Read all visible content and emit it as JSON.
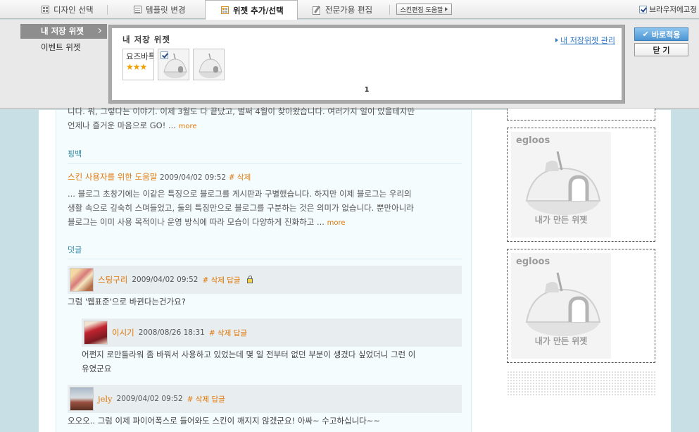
{
  "toolbar": {
    "tabs": [
      {
        "label": "디자인 선택",
        "icon": "grid-icon"
      },
      {
        "label": "템플릿 변경",
        "icon": "lines-icon"
      },
      {
        "label": "위젯 추가/선택",
        "icon": "widget-icon",
        "active": true
      },
      {
        "label": "전문가용 편집",
        "icon": "edit-icon"
      }
    ],
    "help_label": "스킨편집 도움말",
    "fix_label": "브라우저에고정",
    "fix_checked": true
  },
  "panel": {
    "menu": [
      {
        "label": "내 저장 위젯",
        "active": true
      },
      {
        "label": "이벤트 위젯",
        "active": false
      }
    ],
    "box_title": "내 저장 위젯",
    "manage_link": "내 저장위젯 관리",
    "widgets": [
      {
        "label": "요즈바특",
        "rating": "★★★"
      },
      {
        "label": "",
        "checked": true
      },
      {
        "label": ""
      }
    ],
    "page": "1",
    "apply_label": "바로적용",
    "close_label": "닫 기"
  },
  "post": {
    "excerpt_line1": "니다. 뭐, 그렇다는 이야기. 이제 3월도 다 끝났고, 벌써 4월이 찾아왔습니다. 여러가지 일이 있을테지만",
    "excerpt_line2": "언제나 즐거운 마음으로 GO! ...",
    "more": "more"
  },
  "trackback": {
    "section": "핑백",
    "title": "스킨 사용자를 위한 도움말",
    "date": "2009/04/02 09:52",
    "delete": "# 삭제",
    "body_line1": "... 블로그 초창기에는 이같은 특징으로 블로그를 게시판과 구별했습니다. 하지만 이제 블로그는 우리의",
    "body_line2": "생활 속으로 깊숙히 스며들었고, 둘의 특징만으로 블로그를 구분하는 것은 의미가 없습니다. 뿐만아니라",
    "body_line3": "블로그는 이미 사용 목적이나 운영 방식에 따라 모습이 다양하게 진화하고 ...",
    "more": "more"
  },
  "comments": {
    "section": "덧글",
    "items": [
      {
        "name": "스팅구리",
        "date": "2009/04/02 09:52",
        "actions": "# 삭제 답글",
        "body": "그럼 '웹표준'으로 바뀐다는건가요?"
      },
      {
        "name": "이시기",
        "date": "2008/08/26 18:31",
        "actions": "# 삭제 답글",
        "body_line1": "어쩐지 로만틀라워 좀 바꿔서 사용하고 있었는데 몇 일 전부터 없던 부분이 생겼다 싶었더니 그런 이",
        "body_line2": "유였군요"
      },
      {
        "name": "jely",
        "date": "2009/04/02 09:52",
        "actions": "# 삭제 답글",
        "body": "오오오.. 그럼 이제 파이어폭스로 들어와도 스킨이 깨지지 않겠군요! 아싸~ 수고하십니다~~"
      }
    ]
  },
  "sidebar": {
    "widgets": [
      {
        "logo": "egloos",
        "caption": "내가 만든 위젯"
      },
      {
        "logo": "egloos",
        "caption": "내가 만든 위젯"
      }
    ]
  }
}
